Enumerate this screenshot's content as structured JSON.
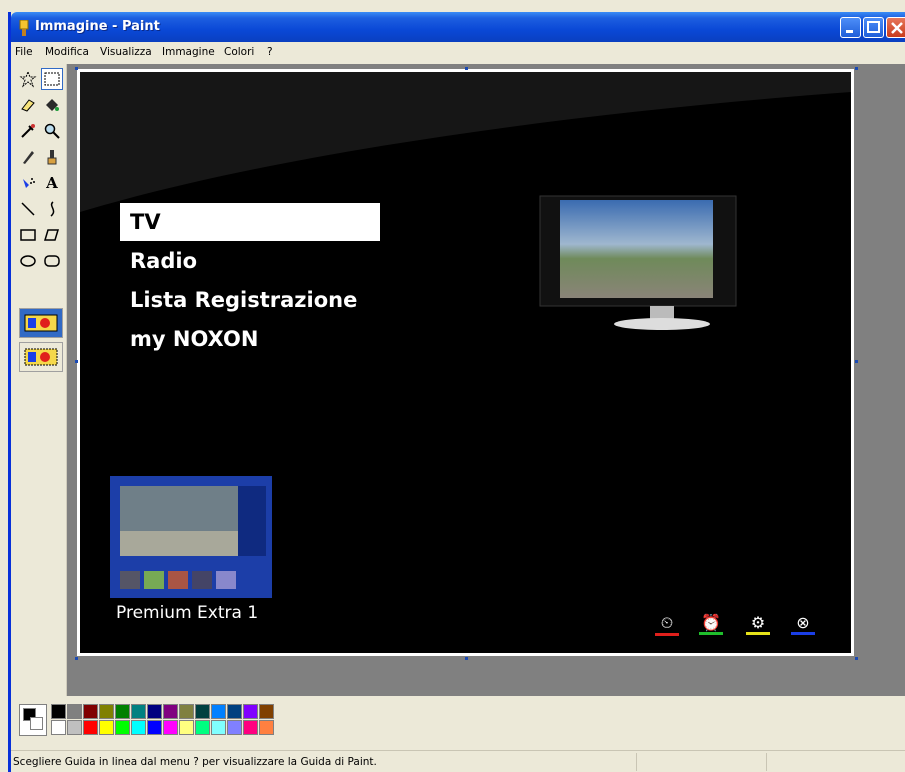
{
  "window": {
    "title": "Immagine - Paint",
    "controls": [
      "minimize",
      "maximize",
      "close"
    ]
  },
  "menubar": {
    "items": [
      "File",
      "Modifica",
      "Visualizza",
      "Immagine",
      "Colori",
      "?"
    ]
  },
  "toolbox": {
    "tools": [
      {
        "name": "free-select-icon",
        "glyph": "☆"
      },
      {
        "name": "rect-select-icon",
        "glyph": "⬚",
        "selected": true
      },
      {
        "name": "eraser-icon",
        "glyph": "⌫"
      },
      {
        "name": "fill-icon",
        "glyph": "◉"
      },
      {
        "name": "color-picker-icon",
        "glyph": "✎"
      },
      {
        "name": "magnifier-icon",
        "glyph": "🔍"
      },
      {
        "name": "pencil-icon",
        "glyph": "✏"
      },
      {
        "name": "brush-icon",
        "glyph": "♙"
      },
      {
        "name": "airbrush-icon",
        "glyph": "✶"
      },
      {
        "name": "text-icon",
        "glyph": "A"
      },
      {
        "name": "line-icon",
        "glyph": "╲"
      },
      {
        "name": "curve-icon",
        "glyph": "∫"
      },
      {
        "name": "rectangle-icon",
        "glyph": "▭"
      },
      {
        "name": "polygon-icon",
        "glyph": "⏢"
      },
      {
        "name": "ellipse-icon",
        "glyph": "⬭"
      },
      {
        "name": "rounded-rect-icon",
        "glyph": "▢"
      }
    ]
  },
  "canvas_image": {
    "menu": [
      "TV",
      "Radio",
      "Lista Registrazione",
      "my NOXON"
    ],
    "selected_index": 0,
    "channel_label": "Premium Extra 1",
    "color_buttons": [
      {
        "name": "timer-icon",
        "glyph": "⏲",
        "color": "#e0201c"
      },
      {
        "name": "alarm-icon",
        "glyph": "⏰",
        "color": "#1fbe2c"
      },
      {
        "name": "settings-icon",
        "glyph": "⚙",
        "color": "#e6e21a"
      },
      {
        "name": "close-icon",
        "glyph": "⊗",
        "color": "#1a3ee6"
      }
    ]
  },
  "palette": {
    "top_row": [
      "#000000",
      "#808080",
      "#800000",
      "#808000",
      "#008000",
      "#008080",
      "#000080",
      "#800080",
      "#808040",
      "#004040",
      "#0080ff",
      "#004080",
      "#8000ff",
      "#804000"
    ],
    "bottom_row": [
      "#ffffff",
      "#c0c0c0",
      "#ff0000",
      "#ffff00",
      "#00ff00",
      "#00ffff",
      "#0000ff",
      "#ff00ff",
      "#ffff80",
      "#00ff80",
      "#80ffff",
      "#8080ff",
      "#ff0080",
      "#ff8040"
    ]
  },
  "status": {
    "text": "Scegliere Guida in linea dal menu ? per visualizzare la Guida di Paint."
  }
}
